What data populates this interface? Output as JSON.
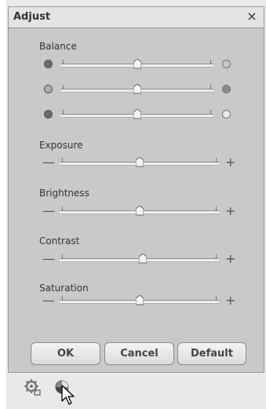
{
  "dialog": {
    "title": "Adjust",
    "close_symbol": "×"
  },
  "balance": {
    "label": "Balance",
    "rows": [
      {
        "left_color": "#6b6b6b",
        "right_color": "#c7c7c7",
        "level": 0.5
      },
      {
        "left_color": "#b0b0b0",
        "right_color": "#8a8a8a",
        "level": 0.5
      },
      {
        "left_color": "#6b6b6b",
        "right_color": "#ececec",
        "level": 0.5
      }
    ]
  },
  "sliders": [
    {
      "label": "Exposure",
      "minus": "—",
      "plus": "+",
      "level": 0.5
    },
    {
      "label": "Brightness",
      "minus": "—",
      "plus": "+",
      "level": 0.5
    },
    {
      "label": "Contrast",
      "minus": "—",
      "plus": "+",
      "level": 0.52
    },
    {
      "label": "Saturation",
      "minus": "—",
      "plus": "+",
      "level": 0.5
    }
  ],
  "buttons": {
    "ok": "OK",
    "cancel": "Cancel",
    "default": "Default"
  },
  "bottom_bar": {
    "icons": [
      "settings-icon",
      "color-adjust-icon",
      "mouse-cursor-icon"
    ]
  }
}
